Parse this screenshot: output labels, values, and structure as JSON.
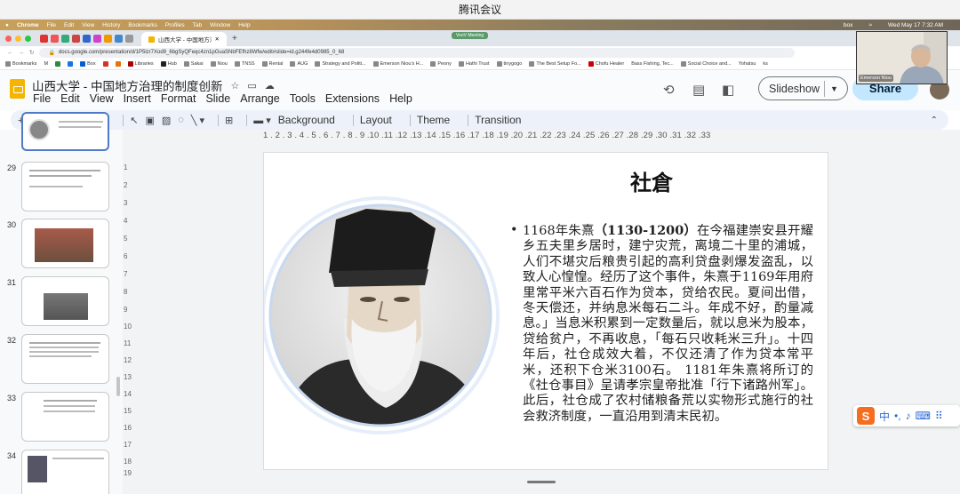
{
  "meeting": {
    "title": "腾讯会议",
    "chip": "VooV Meeting"
  },
  "mac_menu": {
    "items": [
      "Chrome",
      "File",
      "Edit",
      "View",
      "History",
      "Bookmarks",
      "Profiles",
      "Tab",
      "Window",
      "Help"
    ],
    "clock": "Wed May 17  7:32 AM",
    "tray": "box"
  },
  "browser": {
    "tab_title": "山西大学 - 中国地方治理的制度",
    "url": "docs.google.com/presentation/d/1P5lzr7Xod9_6bgSyQFeqc4zn1pGuaSNbFEfhz8Wfw/edit#slide=id.g244fe4d0985_0_68",
    "bookmarks": [
      "Bookmarks",
      "M",
      "Box",
      "Libraries",
      "Hub",
      "Sakai",
      "Niou",
      "TNSS",
      "Rental",
      "AUG",
      "Strategy and Politi...",
      "Emerson Niou's H...",
      "Peony",
      "Hathi Trust",
      "tinygogo",
      "The Best Setup Fo...",
      "Chofu Healer",
      "Bass Fishing, Tec...",
      "Social Choice and...",
      "Yohatsu",
      "ks"
    ]
  },
  "slides_app": {
    "doc_title": "山西大学 - 中国地方治理的制度创新",
    "menu": [
      "File",
      "Edit",
      "View",
      "Insert",
      "Format",
      "Slide",
      "Arrange",
      "Tools",
      "Extensions",
      "Help"
    ],
    "slideshow_label": "Slideshow",
    "share_label": "Share",
    "toolbar_buttons": [
      "Background",
      "Layout",
      "Theme",
      "Transition"
    ]
  },
  "filmstrip": {
    "numbers": [
      "29",
      "30",
      "31",
      "32",
      "33",
      "34"
    ]
  },
  "ruler": {
    "top": "1 . 2 . 3 . 4 . 5 . 6 . 7 . 8 . 9 .10 .11 .12 .13 .14 .15 .16 .17 .18 .19 .20 .21 .22 .23 .24 .25 .26 .27 .28 .29 .30 .31 .32 .33",
    "left": [
      "1",
      "2",
      "3",
      "4",
      "5",
      "6",
      "7",
      "8",
      "9",
      "10",
      "11",
      "12",
      "13",
      "14",
      "15",
      "16",
      "17",
      "18",
      "19"
    ]
  },
  "slide": {
    "title": "社倉",
    "year_prefix": "1168年朱熹",
    "years_bold": "（1130-1200）",
    "body": "在今福建崇安县开耀乡五夫里乡居时，建宁灾荒，离境二十里的浦城，人们不堪灾后粮贵引起的高利贷盘剥爆发盗乱，以致人心惶惶。经历了这个事件，朱熹于1169年用府里常平米六百石作为贷本，贷给农民。夏间出借，冬天偿还，并纳息米每石二斗。年成不好，酌量减息。」当息米积累到一定数量后，就以息米为股本，贷给贫户，不再收息，「每石只收耗米三升」。十四年后，社仓成效大着，不仅还清了作为贷本常平米，还积下仓米3100石。 1181年朱熹将所订的《社仓事目》呈请孝宗皇帝批准「行下诸路州军」。此后，社仓成了农村储粮备荒以实物形式施行的社会救济制度，一直沿用到清末民初。"
  },
  "video": {
    "name": "Emerson Niou"
  },
  "ime": {
    "label": "中"
  }
}
